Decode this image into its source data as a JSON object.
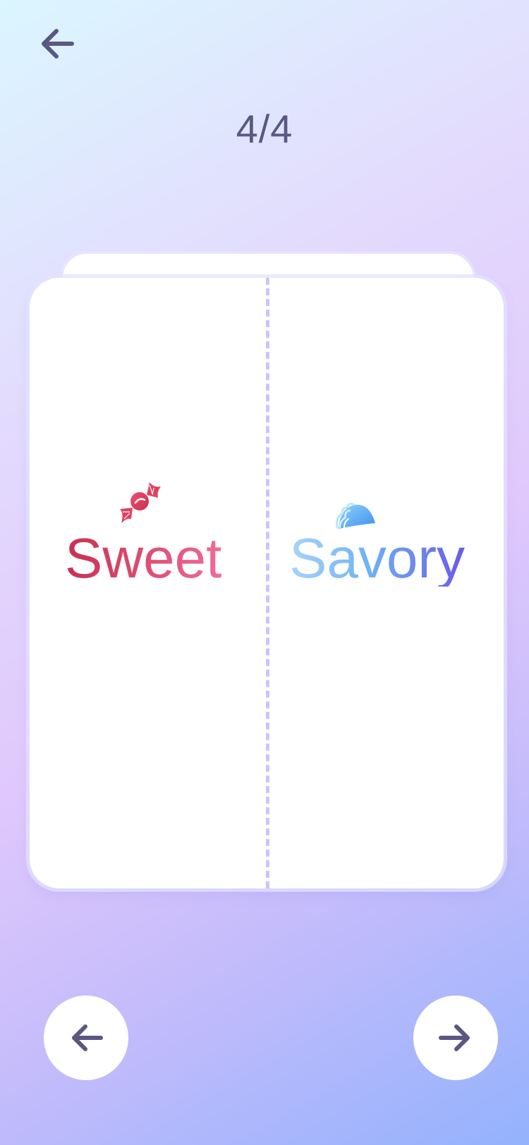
{
  "header": {
    "back_icon": "arrow-left-icon"
  },
  "progress": {
    "label": "4/4",
    "current": 4,
    "total": 4
  },
  "card": {
    "options": [
      {
        "label": "Sweet",
        "icon": "candy-icon",
        "color": "#d6455f"
      },
      {
        "label": "Savory",
        "icon": "taco-icon",
        "color": "#6fb2f5"
      }
    ],
    "divider_color": "#cdc4fb"
  },
  "footer": {
    "prev_icon": "arrow-left-icon",
    "next_icon": "arrow-right-icon"
  },
  "colors": {
    "icon": "#5a5782",
    "background_start": "#dbf6ff",
    "background_end": "#94b2fd"
  }
}
